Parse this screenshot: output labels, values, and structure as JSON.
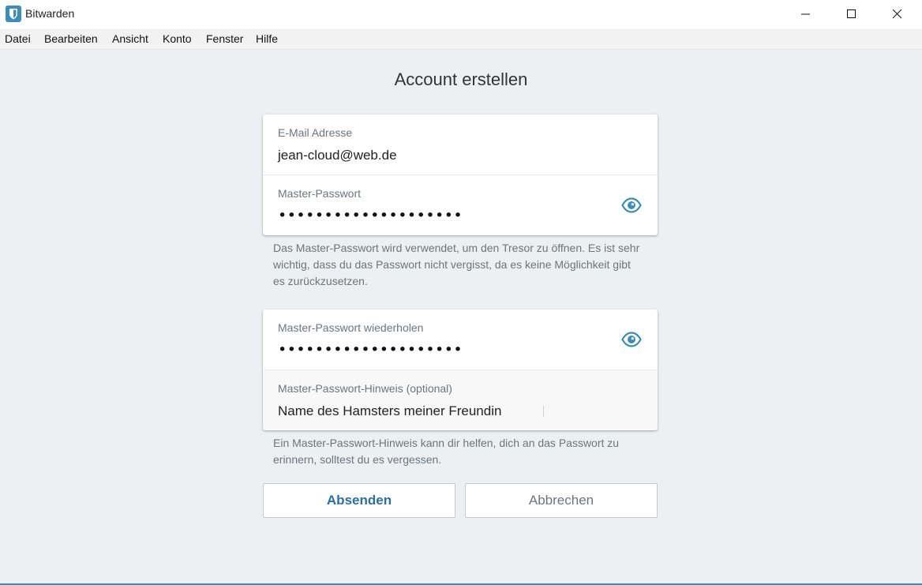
{
  "window": {
    "title": "Bitwarden"
  },
  "menu": [
    "Datei",
    "Bearbeiten",
    "Ansicht",
    "Konto",
    "Fenster",
    "Hilfe"
  ],
  "page": {
    "title": "Account erstellen"
  },
  "form": {
    "email": {
      "label": "E-Mail Adresse",
      "value": "jean-cloud@web.de"
    },
    "master_password": {
      "label": "Master-Passwort",
      "value": "••••••••••••••••••••"
    },
    "master_password_hint_text": "Das Master-Passwort wird verwendet, um den Tresor zu öffnen. Es ist sehr wichtig, dass du das Passwort nicht vergisst, da es keine Möglichkeit gibt es zurückzusetzen.",
    "master_password_repeat": {
      "label": "Master-Passwort wiederholen",
      "value": "••••••••••••••••••••"
    },
    "password_hint": {
      "label": "Master-Passwort-Hinweis (optional)",
      "value": "Name des Hamsters meiner Freundin"
    },
    "password_hint_help": "Ein Master-Passwort-Hinweis kann dir helfen, dich an das Passwort zu erinnern, solltest du es vergessen."
  },
  "buttons": {
    "submit": "Absenden",
    "cancel": "Abbrechen"
  },
  "colors": {
    "accent": "#2a6fa8",
    "eye_icon": "#3c8dbc",
    "background": "#ecf0f3"
  },
  "icons": {
    "app": "bitwarden-shield-icon",
    "minimize": "minimize-icon",
    "maximize": "maximize-icon",
    "close": "close-icon",
    "toggle_visibility": "eye-icon"
  }
}
